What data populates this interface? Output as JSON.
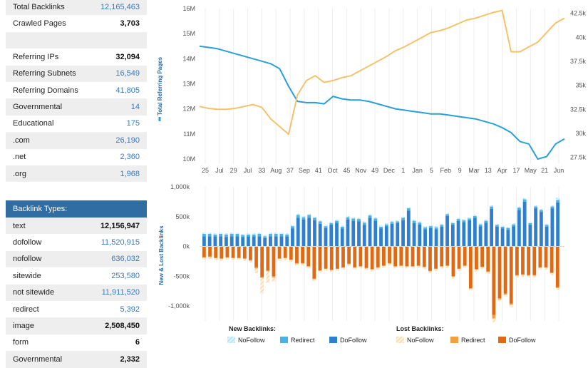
{
  "stats_top": [
    {
      "label": "Total Backlinks",
      "value": "12,165,463",
      "style": "blue"
    },
    {
      "label": "Crawled Pages",
      "value": "3,703",
      "style": "dark"
    },
    {
      "label": "",
      "value": "",
      "style": "dark"
    },
    {
      "label": "Referring IPs",
      "value": "32,094",
      "style": "dark"
    },
    {
      "label": "Referring Subnets",
      "value": "16,549",
      "style": "blue"
    },
    {
      "label": "Referring Domains",
      "value": "41,805",
      "style": "blue"
    },
    {
      "label": "Governmental",
      "value": "14",
      "style": "blue"
    },
    {
      "label": "Educational",
      "value": "175",
      "style": "blue"
    },
    {
      "label": ".com",
      "value": "26,190",
      "style": "blue"
    },
    {
      "label": ".net",
      "value": "2,360",
      "style": "blue"
    },
    {
      "label": ".org",
      "value": "1,968",
      "style": "blue"
    }
  ],
  "backlink_types": {
    "header": "Backlink Types:",
    "rows": [
      {
        "label": "text",
        "value": "12,156,947",
        "style": "dark"
      },
      {
        "label": "dofollow",
        "value": "11,520,915",
        "style": "blue"
      },
      {
        "label": "nofollow",
        "value": "636,032",
        "style": "blue"
      },
      {
        "label": "sitewide",
        "value": "253,580",
        "style": "blue"
      },
      {
        "label": "not sitewide",
        "value": "11,911,520",
        "style": "blue"
      },
      {
        "label": "redirect",
        "value": "5,392",
        "style": "blue"
      },
      {
        "label": "image",
        "value": "2,508,450",
        "style": "dark"
      },
      {
        "label": "form",
        "value": "6",
        "style": "dark"
      },
      {
        "label": "Governmental",
        "value": "2,332",
        "style": "dark"
      }
    ]
  },
  "colors": {
    "blue_line": "#2a9fd8",
    "orange_line": "#f5c26b",
    "dofollow_new": "#2f7fd0",
    "redirect_new": "#49b2e6",
    "nofollow_new": "#9fdcf2",
    "dofollow_lost": "#e06a14",
    "redirect_lost": "#f0a040",
    "nofollow_lost": "#f6d39a"
  },
  "chart_data": [
    {
      "type": "line",
      "ylabel": "Total Referring Pages",
      "y_left_ticks": [
        "16M",
        "15M",
        "14M",
        "13M",
        "12M",
        "11M",
        "10M"
      ],
      "y_left_range": [
        9.8,
        16
      ],
      "y_right_ticks": [
        "42.5k",
        "40k",
        "37.5k",
        "35k",
        "32.5k",
        "30k",
        "27.5k"
      ],
      "y_right_range": [
        26800,
        43000
      ],
      "x_ticks": [
        "25",
        "Jul",
        "29",
        "Jul",
        "33",
        "Aug",
        "37",
        "Sep",
        "41",
        "Oct",
        "45",
        "Nov",
        "49",
        "Dec",
        "1",
        "Jan",
        "5",
        "Feb",
        "9",
        "Mar",
        "13",
        "Apr",
        "17",
        "May",
        "21",
        "Jun"
      ],
      "series": [
        {
          "name": "Total Referring Pages",
          "axis": "left",
          "color": "blue",
          "values": [
            14.5,
            14.45,
            14.4,
            14.3,
            14.2,
            14.1,
            14.0,
            13.9,
            13.8,
            13.6,
            12.9,
            12.3,
            12.25,
            12.25,
            12.2,
            12.5,
            12.4,
            12.35,
            12.35,
            12.3,
            12.2,
            12.1,
            12.0,
            11.95,
            11.9,
            11.85,
            11.8,
            11.8,
            11.75,
            11.7,
            11.65,
            11.6,
            11.5,
            11.4,
            11.25,
            11.05,
            10.7,
            10.6,
            10.0,
            10.1,
            10.6,
            10.8
          ]
        },
        {
          "axis": "right",
          "color": "orange",
          "values": [
            32.8,
            32.6,
            32.5,
            32.5,
            32.6,
            32.8,
            33.0,
            32.7,
            31.5,
            30.7,
            29.9,
            34.0,
            35.5,
            36.0,
            35.3,
            35.5,
            35.8,
            36.0,
            36.5,
            37.0,
            37.5,
            38.0,
            38.6,
            39.0,
            39.5,
            40.0,
            40.5,
            40.7,
            41.0,
            41.4,
            41.8,
            42.0,
            42.3,
            42.6,
            42.8,
            38.5,
            38.5,
            39.0,
            39.5,
            40.5,
            41.5,
            42.0
          ]
        }
      ]
    },
    {
      "type": "bar",
      "ylabel": "New & Lost Backlinks",
      "y_ticks": [
        "1,000k",
        "500k",
        "0k",
        "-500k",
        "-1,000k"
      ],
      "ylim": [
        -1250,
        1000
      ],
      "legend": {
        "new_title": "New Backlinks:",
        "lost_title": "Lost Backlinks:",
        "new_items": [
          "NoFollow",
          "Redirect",
          "DoFollow"
        ],
        "lost_items": [
          "NoFollow",
          "Redirect",
          "DoFollow"
        ]
      },
      "new_dofollow": [
        170,
        170,
        170,
        170,
        160,
        170,
        170,
        160,
        170,
        170,
        170,
        140,
        170,
        170,
        170,
        170,
        300,
        480,
        450,
        480,
        440,
        380,
        310,
        360,
        400,
        300,
        450,
        430,
        420,
        360,
        480,
        430,
        300,
        340,
        380,
        390,
        440,
        600,
        390,
        370,
        290,
        310,
        290,
        330,
        510,
        360,
        430,
        410,
        440,
        480,
        340,
        400,
        630,
        330,
        300,
        280,
        340,
        610,
        750,
        360,
        640,
        580,
        330,
        640,
        740
      ],
      "new_redirect": [
        40,
        40,
        30,
        40,
        40,
        40,
        40,
        30,
        30,
        30,
        40,
        30,
        40,
        40,
        40,
        30,
        40,
        50,
        40,
        50,
        40,
        40,
        30,
        30,
        30,
        30,
        40,
        40,
        40,
        40,
        40,
        40,
        30,
        30,
        30,
        30,
        40,
        40,
        40,
        30,
        30,
        30,
        30,
        30,
        30,
        30,
        30,
        30,
        30,
        30,
        30,
        30,
        40,
        30,
        30,
        30,
        30,
        40,
        40,
        30,
        30,
        30,
        30,
        30,
        40
      ],
      "new_nofollow": [
        20,
        20,
        20,
        20,
        20,
        20,
        20,
        20,
        20,
        20,
        20,
        20,
        20,
        20,
        20,
        20,
        20,
        20,
        20,
        20,
        20,
        20,
        20,
        20,
        20,
        20,
        20,
        20,
        20,
        20,
        20,
        20,
        20,
        20,
        20,
        20,
        20,
        20,
        20,
        20,
        20,
        20,
        20,
        20,
        20,
        20,
        20,
        20,
        20,
        20,
        20,
        20,
        20,
        20,
        20,
        20,
        20,
        20,
        20,
        20,
        20,
        20,
        20,
        20,
        40
      ],
      "lost_dofollow": [
        -180,
        -170,
        -190,
        -200,
        -180,
        -190,
        -190,
        -200,
        -230,
        -350,
        -510,
        -400,
        -500,
        -200,
        -190,
        -220,
        -280,
        -280,
        -330,
        -540,
        -400,
        -370,
        -390,
        -370,
        -350,
        -290,
        -350,
        -330,
        -360,
        -380,
        -350,
        -320,
        -280,
        -330,
        -320,
        -330,
        -330,
        -320,
        -340,
        -410,
        -370,
        -330,
        -320,
        -500,
        -370,
        -320,
        -700,
        -380,
        -340,
        -420,
        -1150,
        -870,
        -790,
        -960,
        -480,
        -470,
        -480,
        -480,
        -350,
        -350,
        -440,
        -680
      ],
      "lost_redirect": [
        -10,
        -10,
        -10,
        -10,
        -10,
        -10,
        -10,
        -10,
        -10,
        -20,
        -20,
        -20,
        -20,
        -10,
        -10,
        -10,
        -10,
        -10,
        -10,
        -10,
        -10,
        -10,
        -10,
        -10,
        -10,
        -10,
        -10,
        -10,
        -10,
        -10,
        -10,
        -10,
        -10,
        -10,
        -10,
        -10,
        -10,
        -10,
        -10,
        -10,
        -10,
        -10,
        -10,
        -10,
        -10,
        -10,
        -10,
        -10,
        -10,
        -10,
        -60,
        -20,
        -20,
        -20,
        -10,
        -10,
        -10,
        -10,
        -10,
        -10,
        -10,
        -20
      ],
      "lost_nofollow": [
        -30,
        -30,
        -30,
        -30,
        -30,
        -30,
        -30,
        -30,
        -30,
        -80,
        -260,
        -190,
        -70,
        -30,
        -30,
        -30,
        -30,
        -30,
        -30,
        -30,
        -30,
        -30,
        -30,
        -30,
        -30,
        -30,
        -30,
        -30,
        -30,
        -30,
        -30,
        -30,
        -30,
        -30,
        -30,
        -30,
        -30,
        -30,
        -30,
        -30,
        -30,
        -30,
        -30,
        -30,
        -30,
        -30,
        -30,
        -30,
        -30,
        -30,
        -60,
        -30,
        -30,
        -40,
        -30,
        -30,
        -30,
        -30,
        -30,
        -30,
        -30,
        -30
      ]
    }
  ]
}
